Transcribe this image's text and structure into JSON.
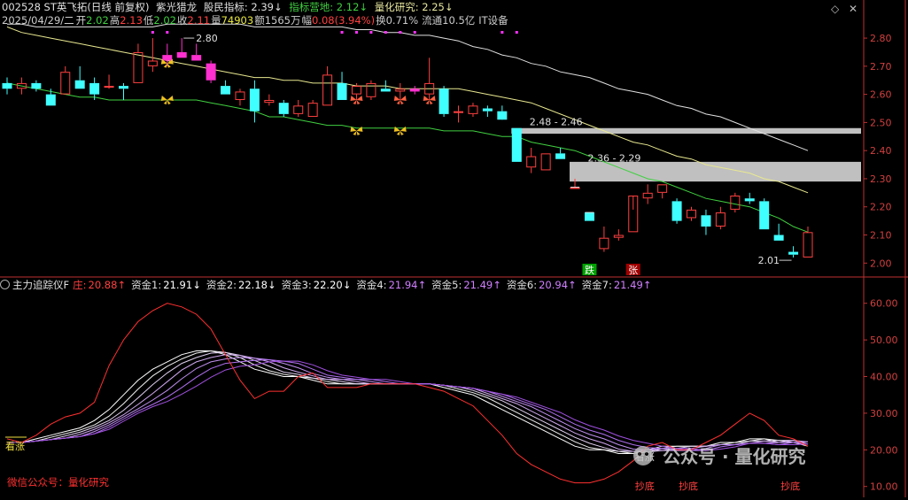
{
  "header": {
    "code_name": "002528 ST英飞拓(日线 前复权)",
    "indicator1_name": "紫光猎龙",
    "indicator1_label": "股民指标:",
    "indicator1_value": "2.39↓",
    "indicator2_label": "指标营地:",
    "indicator2_value": "2.12↓",
    "indicator3_label": "量化研究:",
    "indicator3_value": "2.25↓",
    "date": "2025/04/29/二",
    "open_label": "开",
    "open": "2.02",
    "high_label": "高",
    "high": "2.13",
    "low_label": "低",
    "low": "2.02",
    "close_label": "收",
    "close": "2.11",
    "vol_label": "量",
    "vol": "74903",
    "amt_label": "额",
    "amt": "1565万",
    "change_label": "幅",
    "change": "0.08(3.94%)",
    "turnover_label": "换",
    "turnover": "0.71%",
    "float_label": "流通",
    "float": "10.5亿",
    "sector": "IT设备",
    "diamond_icon": "◇",
    "close_icon": "✕"
  },
  "lower_header": {
    "indicator_name": "主力追踪仪F",
    "items": [
      {
        "label": "庄:",
        "value": "20.88↑",
        "color": "#ff4040"
      },
      {
        "label": "资金1:",
        "value": "21.91↓",
        "color": "#ffffff"
      },
      {
        "label": "资金2:",
        "value": "22.18↓",
        "color": "#ffffff"
      },
      {
        "label": "资金3:",
        "value": "22.20↓",
        "color": "#ffffff"
      },
      {
        "label": "资金4:",
        "value": "21.94↑",
        "color": "#d080ff"
      },
      {
        "label": "资金5:",
        "value": "21.49↑",
        "color": "#d080ff"
      },
      {
        "label": "资金6:",
        "value": "20.94↑",
        "color": "#d080ff"
      },
      {
        "label": "资金7:",
        "value": "21.49↑",
        "color": "#d080ff"
      }
    ]
  },
  "annotations": {
    "hi_label": "2.80",
    "zone1_label": "2.48 - 2.46",
    "zone2_label": "2.36 - 2.29",
    "low_label": "2.01",
    "die_tag": "跌",
    "zhang_tag": "张",
    "kanzhang_left": "看涨",
    "kanzhang_right": "看涨",
    "chaodi": "抄底",
    "wechat": "微信公众号：量化研究",
    "watermark": "公众号 · 量化研究"
  },
  "colors": {
    "up": "#ff4040",
    "down": "#40ffff",
    "pink": "#ff30d0",
    "ma_yellow": "#e8e890",
    "ma_white": "#e0e0e0",
    "ma_green": "#40d040",
    "zone": "#c0c0c0",
    "axis": "#c03030"
  },
  "chart_data": [
    {
      "type": "candlestick",
      "title": "002528 ST英飞拓(日线 前复权)",
      "ylim": [
        1.96,
        2.86
      ],
      "yticks": [
        "2.80",
        "2.70",
        "2.60",
        "2.50",
        "2.40",
        "2.30",
        "2.20",
        "2.10",
        "2.00"
      ],
      "candles": [
        [
          2.64,
          2.66,
          2.6,
          2.62
        ],
        [
          2.62,
          2.66,
          2.6,
          2.64
        ],
        [
          2.64,
          2.65,
          2.61,
          2.62
        ],
        [
          2.6,
          2.62,
          2.56,
          2.56
        ],
        [
          2.6,
          2.7,
          2.6,
          2.68
        ],
        [
          2.65,
          2.7,
          2.62,
          2.62
        ],
        [
          2.64,
          2.66,
          2.58,
          2.6
        ],
        [
          2.63,
          2.67,
          2.62,
          2.63
        ],
        [
          2.63,
          2.64,
          2.58,
          2.62
        ],
        [
          2.64,
          2.78,
          2.64,
          2.75
        ],
        [
          2.7,
          2.8,
          2.68,
          2.72
        ],
        [
          2.72,
          2.78,
          2.7,
          2.74
        ],
        [
          2.75,
          2.8,
          2.73,
          2.73
        ],
        [
          2.74,
          2.78,
          2.72,
          2.72
        ],
        [
          2.71,
          2.72,
          2.64,
          2.65
        ],
        [
          2.63,
          2.65,
          2.6,
          2.6
        ],
        [
          2.58,
          2.62,
          2.56,
          2.61
        ],
        [
          2.62,
          2.65,
          2.5,
          2.54
        ],
        [
          2.57,
          2.6,
          2.56,
          2.58
        ],
        [
          2.57,
          2.58,
          2.52,
          2.53
        ],
        [
          2.53,
          2.58,
          2.52,
          2.56
        ],
        [
          2.52,
          2.58,
          2.52,
          2.57
        ],
        [
          2.56,
          2.7,
          2.56,
          2.67
        ],
        [
          2.64,
          2.68,
          2.58,
          2.58
        ],
        [
          2.6,
          2.64,
          2.58,
          2.63
        ],
        [
          2.59,
          2.65,
          2.58,
          2.64
        ],
        [
          2.62,
          2.65,
          2.61,
          2.61
        ],
        [
          2.61,
          2.64,
          2.58,
          2.62
        ],
        [
          2.61,
          2.63,
          2.6,
          2.62
        ],
        [
          2.6,
          2.73,
          2.58,
          2.64
        ],
        [
          2.62,
          2.63,
          2.52,
          2.53
        ],
        [
          2.54,
          2.56,
          2.5,
          2.54
        ],
        [
          2.53,
          2.57,
          2.52,
          2.56
        ],
        [
          2.55,
          2.56,
          2.52,
          2.54
        ],
        [
          2.54,
          2.56,
          2.52,
          2.51
        ],
        [
          2.48,
          2.48,
          2.36,
          2.36
        ],
        [
          2.34,
          2.41,
          2.32,
          2.38
        ],
        [
          2.33,
          2.39,
          2.33,
          2.39
        ],
        [
          2.39,
          2.41,
          2.37,
          2.37
        ],
        [
          2.27,
          2.3,
          2.27,
          2.27
        ],
        [
          2.18,
          2.18,
          2.15,
          2.15
        ],
        [
          2.05,
          2.13,
          2.04,
          2.09
        ],
        [
          2.09,
          2.12,
          2.08,
          2.1
        ],
        [
          2.11,
          2.19,
          2.11,
          2.24
        ],
        [
          2.23,
          2.28,
          2.21,
          2.25
        ],
        [
          2.25,
          2.28,
          2.23,
          2.28
        ],
        [
          2.22,
          2.23,
          2.14,
          2.15
        ],
        [
          2.16,
          2.2,
          2.15,
          2.19
        ],
        [
          2.17,
          2.19,
          2.1,
          2.13
        ],
        [
          2.13,
          2.2,
          2.12,
          2.18
        ],
        [
          2.19,
          2.25,
          2.18,
          2.24
        ],
        [
          2.23,
          2.25,
          2.21,
          2.22
        ],
        [
          2.22,
          2.23,
          2.12,
          2.12
        ],
        [
          2.1,
          2.14,
          2.08,
          2.08
        ],
        [
          2.04,
          2.06,
          2.02,
          2.03
        ],
        [
          2.02,
          2.13,
          2.02,
          2.11
        ]
      ],
      "ma_yellow": [
        2.84,
        2.82,
        2.81,
        2.8,
        2.79,
        2.78,
        2.77,
        2.76,
        2.75,
        2.74,
        2.73,
        2.72,
        2.71,
        2.7,
        2.69,
        2.68,
        2.67,
        2.66,
        2.66,
        2.65,
        2.65,
        2.64,
        2.64,
        2.64,
        2.63,
        2.63,
        2.63,
        2.62,
        2.62,
        2.62,
        2.62,
        2.62,
        2.61,
        2.6,
        2.59,
        2.58,
        2.57,
        2.55,
        2.53,
        2.51,
        2.49,
        2.47,
        2.45,
        2.43,
        2.42,
        2.4,
        2.38,
        2.37,
        2.35,
        2.34,
        2.33,
        2.32,
        2.3,
        2.29,
        2.27,
        2.25
      ],
      "ma_white": [
        2.85,
        2.85,
        2.84,
        2.84,
        2.84,
        2.84,
        2.84,
        2.84,
        2.84,
        2.84,
        2.84,
        2.85,
        2.85,
        2.85,
        2.85,
        2.85,
        2.85,
        2.84,
        2.84,
        2.84,
        2.84,
        2.84,
        2.84,
        2.84,
        2.83,
        2.83,
        2.82,
        2.82,
        2.81,
        2.81,
        2.8,
        2.79,
        2.77,
        2.76,
        2.74,
        2.73,
        2.71,
        2.7,
        2.68,
        2.67,
        2.66,
        2.64,
        2.62,
        2.61,
        2.6,
        2.58,
        2.56,
        2.55,
        2.53,
        2.52,
        2.5,
        2.48,
        2.46,
        2.44,
        2.42,
        2.4
      ],
      "ma_green": [
        2.64,
        2.63,
        2.62,
        2.61,
        2.6,
        2.59,
        2.59,
        2.58,
        2.58,
        2.58,
        2.58,
        2.58,
        2.58,
        2.58,
        2.57,
        2.56,
        2.55,
        2.54,
        2.52,
        2.52,
        2.51,
        2.5,
        2.49,
        2.49,
        2.48,
        2.48,
        2.48,
        2.48,
        2.48,
        2.48,
        2.47,
        2.47,
        2.47,
        2.46,
        2.45,
        2.45,
        2.43,
        2.42,
        2.41,
        2.4,
        2.38,
        2.36,
        2.34,
        2.32,
        2.3,
        2.29,
        2.27,
        2.25,
        2.23,
        2.22,
        2.21,
        2.2,
        2.18,
        2.16,
        2.13,
        2.11
      ],
      "resistance_zones": [
        [
          2.46,
          2.48
        ],
        [
          2.29,
          2.36
        ]
      ],
      "butterflies": [
        [
          11,
          2.71
        ],
        [
          11,
          2.58
        ],
        [
          24,
          2.58
        ],
        [
          27,
          2.58
        ],
        [
          29,
          2.58
        ],
        [
          24,
          2.47
        ],
        [
          27,
          2.47
        ]
      ],
      "top_markers": [
        10,
        11,
        23,
        24,
        25,
        26,
        27,
        28,
        34,
        35
      ]
    },
    {
      "type": "line",
      "title": "主力追踪仪F",
      "ylim": [
        8,
        65
      ],
      "yticks": [
        "60.00",
        "50.00",
        "40.00",
        "30.00",
        "20.00",
        "10.00"
      ],
      "zhuang": [
        23,
        22,
        24,
        27,
        29,
        30,
        33,
        43,
        50,
        55,
        58,
        60,
        59,
        57,
        53,
        46,
        39,
        34,
        36,
        36,
        40,
        41,
        37,
        37,
        37,
        38,
        38,
        38,
        38,
        37,
        36,
        34,
        32,
        28,
        24,
        19,
        16,
        14,
        12,
        11,
        11,
        12,
        14,
        17,
        21,
        22,
        20,
        20,
        22,
        24,
        27,
        30,
        28,
        24,
        23,
        21
      ],
      "funds_base": [
        22,
        22,
        23,
        24,
        25,
        26,
        28,
        31,
        35,
        39,
        42,
        44,
        46,
        47,
        47,
        46,
        44,
        42,
        41,
        40,
        40,
        39,
        38,
        38,
        38,
        38,
        38,
        38,
        38,
        38,
        37,
        36,
        35,
        33,
        31,
        29,
        27,
        25,
        23,
        21,
        20,
        20,
        19,
        19,
        20,
        21,
        21,
        21,
        21,
        22,
        22,
        23,
        23,
        22,
        22,
        21
      ]
    }
  ]
}
